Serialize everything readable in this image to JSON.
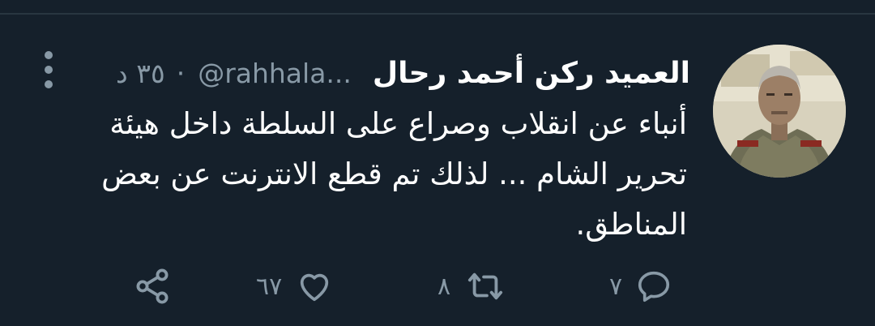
{
  "tweet": {
    "display_name": "العميد ركن أحمد رحال",
    "handle": "@rahhala...",
    "separator": "·",
    "timestamp": "٣٥ د",
    "text": "أنباء عن انقلاب وصراع على السلطة داخل هيئة تحرير الشام ... لذلك تم قطع الانترنت عن بعض المناطق.",
    "avatar_icon": "profile-photo-military-officer"
  },
  "actions": {
    "reply": {
      "icon": "reply-icon",
      "count": "٧"
    },
    "retweet": {
      "icon": "retweet-icon",
      "count": "٨"
    },
    "like": {
      "icon": "heart-icon",
      "count": "٦٧"
    },
    "share": {
      "icon": "share-icon",
      "count": ""
    }
  },
  "colors": {
    "background": "#15202b",
    "text_primary": "#ffffff",
    "text_secondary": "#8899a6",
    "divider": "#283640"
  }
}
